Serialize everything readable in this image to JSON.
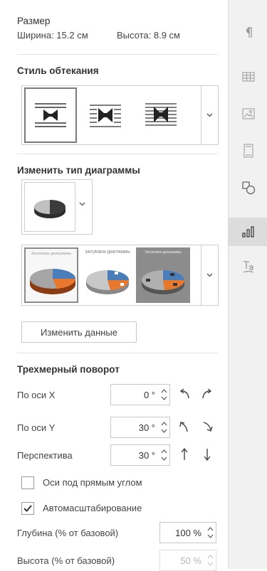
{
  "size": {
    "title": "Размер",
    "width_text": "Ширина: 15.2 см",
    "height_text": "Высота: 8.9 см"
  },
  "wrap": {
    "title": "Стиль обтекания",
    "selected_index": 0
  },
  "chart_type": {
    "title": "Изменить тип диаграммы"
  },
  "chart_styles": {
    "thumb_captions": [
      "Заголовок диаграммы",
      "ЗАГОЛОВОК ДИАГРАММЫ",
      "Заголовок диаграммы"
    ],
    "selected_index": 0
  },
  "edit_data_button": "Изменить данные",
  "rotation": {
    "title": "Трехмерный поворот",
    "x_label": "По оси X",
    "x_value": "0 °",
    "y_label": "По оси Y",
    "y_value": "30 °",
    "perspective_label": "Перспектива",
    "perspective_value": "30 °"
  },
  "options": {
    "right_angle_label": "Оси под прямым углом",
    "right_angle_checked": false,
    "autoscale_label": "Автомасштабирование",
    "autoscale_checked": true
  },
  "depth": {
    "label": "Глубина (% от базовой)",
    "value": "100 %"
  },
  "height": {
    "label": "Высота (% от базовой)",
    "value": "50 %"
  },
  "colors": {
    "accent_blue": "#4a7ebb",
    "accent_orange": "#e8782e",
    "pie_gray": "#a5a5a5",
    "pie_dark": "#404040",
    "active_tab_bg": "#dcdcdc"
  },
  "right_toolbar": {
    "icons": [
      "paragraph-icon",
      "table-icon",
      "image-icon",
      "header-footer-icon",
      "shape-icon",
      "chart-icon",
      "text-art-icon"
    ],
    "active": "chart-icon"
  }
}
